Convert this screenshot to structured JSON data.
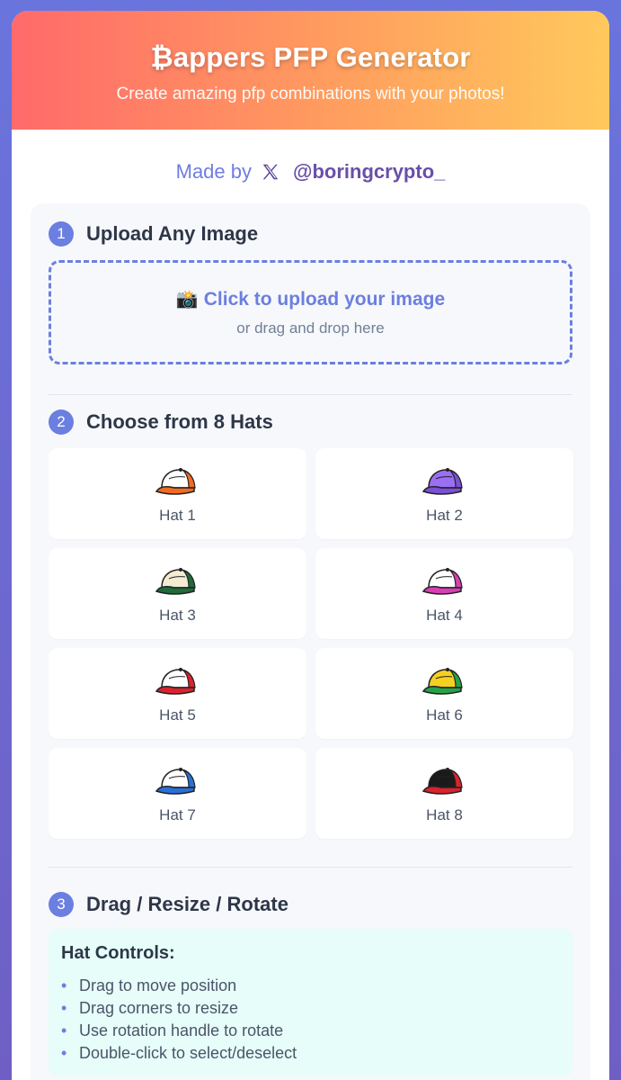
{
  "header": {
    "title": "₿appers PFP Generator",
    "subtitle": "Create amazing pfp combinations with your photos!"
  },
  "credit": {
    "prefix": "Made by",
    "icon": "x-logo-icon",
    "handle": "@boringcrypto_"
  },
  "step1": {
    "number": "1",
    "title": "Upload Any Image",
    "upload_icon": "📸",
    "upload_main": "Click to upload your image",
    "upload_sub": "or drag and drop here"
  },
  "step2": {
    "number": "2",
    "title": "Choose from 8 Hats",
    "hats": [
      {
        "label": "Hat 1",
        "color": "#f26b21",
        "crown": "#ffffff"
      },
      {
        "label": "Hat 2",
        "color": "#7b4fd6",
        "crown": "#9b6ff2"
      },
      {
        "label": "Hat 3",
        "color": "#1f6b3a",
        "crown": "#f3ecd3"
      },
      {
        "label": "Hat 4",
        "color": "#d93fb5",
        "crown": "#ffffff"
      },
      {
        "label": "Hat 5",
        "color": "#d9232e",
        "crown": "#ffffff"
      },
      {
        "label": "Hat 6",
        "color": "#25a24a",
        "crown": "#f5d020"
      },
      {
        "label": "Hat 7",
        "color": "#2a6fd6",
        "crown": "#ffffff"
      },
      {
        "label": "Hat 8",
        "color": "#d9232e",
        "crown": "#1a1a1a"
      }
    ]
  },
  "step3": {
    "number": "3",
    "title": "Drag / Resize / Rotate",
    "controls_title": "Hat Controls:",
    "controls_items": [
      "Drag to move position",
      "Drag corners to resize",
      "Use rotation handle to rotate",
      "Double-click to select/deselect"
    ]
  },
  "colors": {
    "accent": "#6b7fe0",
    "header_gradient_start": "#ff6a6a",
    "header_gradient_end": "#ffc95c",
    "controls_bg": "#e6fdf9"
  }
}
